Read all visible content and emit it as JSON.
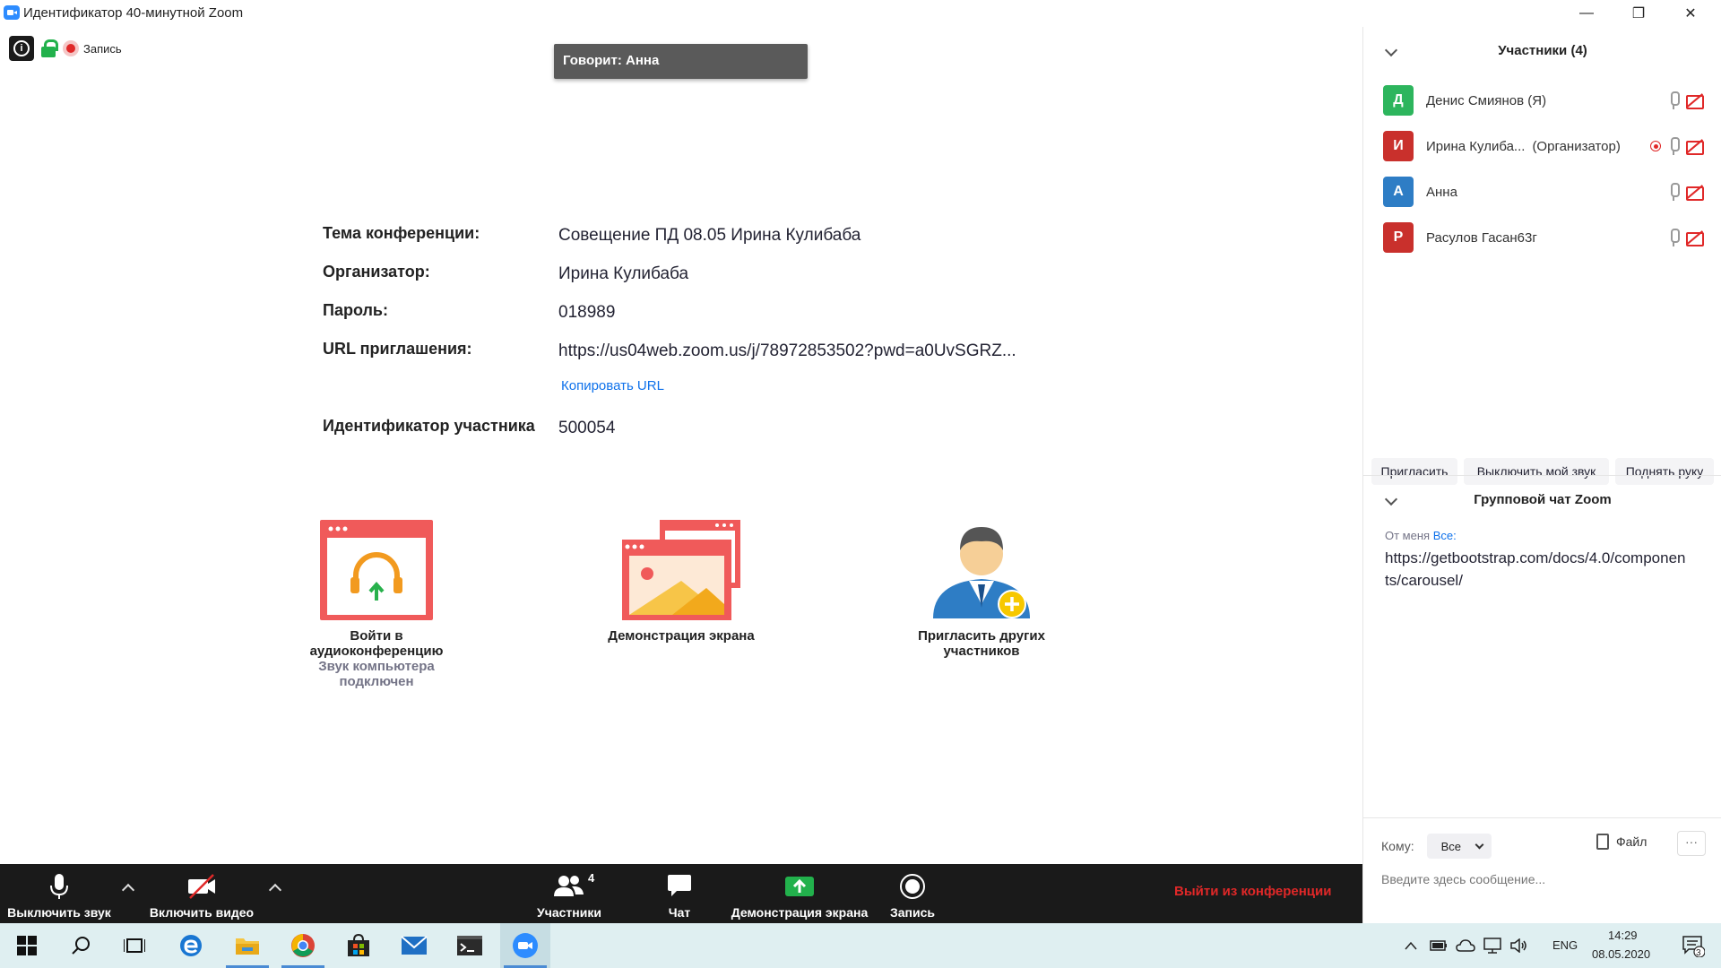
{
  "window": {
    "title": "Идентификатор 40-минутной Zoom",
    "minimize": "—",
    "restore": "❐",
    "close": "✕"
  },
  "status": {
    "recording_label": "Запись"
  },
  "speaker": {
    "label": "Говорит: Анна"
  },
  "meeting": {
    "topic_label": "Тема конференции:",
    "topic_value": "Совещение ПД 08.05 Ирина Кулибаба",
    "host_label": "Организатор:",
    "host_value": "Ирина Кулибаба",
    "password_label": "Пароль:",
    "password_value": "018989",
    "url_label": "URL приглашения:",
    "url_value": "https://us04web.zoom.us/j/78972853502?pwd=a0UvSGRZ...",
    "copy_url": "Копировать URL",
    "participant_id_label": "Идентификатор участника",
    "participant_id_value": "500054"
  },
  "tiles": {
    "audio_title_1": "Войти в",
    "audio_title_2": "аудиоконференцию",
    "audio_sub_1": "Звук компьютера",
    "audio_sub_2": "подключен",
    "share": "Демонстрация экрана",
    "invite_1": "Пригласить других",
    "invite_2": "участников"
  },
  "participants_panel": {
    "header": "Участники (4)",
    "items": [
      {
        "initial": "Д",
        "name": "Денис Смиянов (Я)",
        "role": "",
        "color": "#2db55d"
      },
      {
        "initial": "И",
        "name": "Ирина Кулиба...",
        "role": "(Организатор)",
        "color": "#c9302c"
      },
      {
        "initial": "А",
        "name": "Анна",
        "role": "",
        "color": "#2e7dc5"
      },
      {
        "initial": "Р",
        "name": "Расулов Гасан63г",
        "role": "",
        "color": "#c9302c"
      }
    ],
    "invite_button": "Пригласить",
    "mute_me_button": "Выключить мой звук",
    "raise_hand_button": "Поднять руку"
  },
  "chat": {
    "header": "Групповой чат Zoom",
    "from_label": "От меня",
    "to_all": "Все:",
    "message": "https://getbootstrap.com/docs/4.0/components/carousel/",
    "to_label": "Кому:",
    "to_value": "Все",
    "file_label": "Файл",
    "more_label": "···",
    "input_placeholder": "Введите здесь сообщение..."
  },
  "toolbar": {
    "mute": "Выключить звук",
    "video": "Включить видео",
    "participants": "Участники",
    "participants_count": "4",
    "chat": "Чат",
    "share": "Демонстрация экрана",
    "record": "Запись",
    "leave": "Выйти из конференции"
  },
  "taskbar": {
    "lang": "ENG",
    "time": "14:29",
    "date": "08.05.2020",
    "notifications": "3"
  }
}
